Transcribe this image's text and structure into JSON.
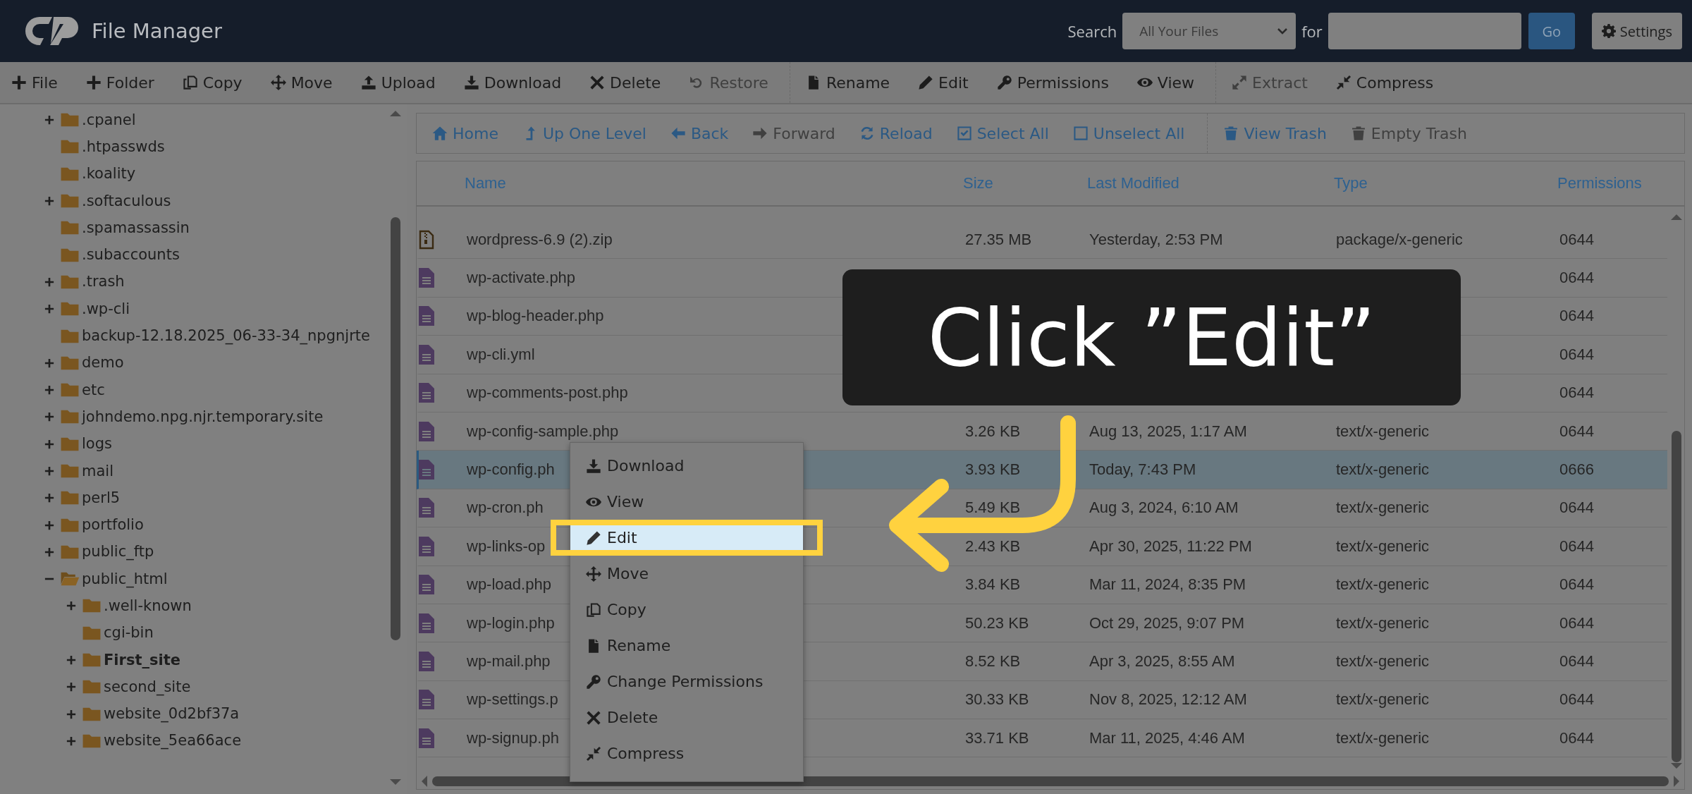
{
  "header": {
    "title": "File Manager",
    "search_label": "Search",
    "search_scope": "All Your Files",
    "for_label": "for",
    "go": "Go",
    "settings": "Settings"
  },
  "toolbar": [
    {
      "items": [
        {
          "kind": "file",
          "label": "File",
          "disabled": false
        },
        {
          "kind": "folder",
          "label": "Folder",
          "disabled": false
        },
        {
          "kind": "copy",
          "label": "Copy",
          "disabled": false
        },
        {
          "kind": "move",
          "label": "Move",
          "disabled": false
        },
        {
          "kind": "upload",
          "label": "Upload",
          "disabled": false
        },
        {
          "kind": "download",
          "label": "Download",
          "disabled": false
        },
        {
          "kind": "delete",
          "label": "Delete",
          "disabled": false
        },
        {
          "kind": "restore",
          "label": "Restore",
          "disabled": true
        }
      ]
    },
    {
      "items": [
        {
          "kind": "rename",
          "label": "Rename",
          "disabled": false
        },
        {
          "kind": "edit",
          "label": "Edit",
          "disabled": false
        },
        {
          "kind": "permissions",
          "label": "Permissions",
          "disabled": false
        },
        {
          "kind": "view",
          "label": "View",
          "disabled": false
        }
      ]
    },
    {
      "items": [
        {
          "kind": "extract",
          "label": "Extract",
          "disabled": true
        },
        {
          "kind": "compress",
          "label": "Compress",
          "disabled": false
        }
      ]
    }
  ],
  "tree": [
    {
      "label": ".cpanel",
      "expandable": true,
      "expanded": false,
      "selected": false
    },
    {
      "label": ".htpasswds",
      "expandable": false,
      "expanded": false,
      "selected": false
    },
    {
      "label": ".koality",
      "expandable": false,
      "expanded": false,
      "selected": false
    },
    {
      "label": ".softaculous",
      "expandable": true,
      "expanded": false,
      "selected": false
    },
    {
      "label": ".spamassassin",
      "expandable": false,
      "expanded": false,
      "selected": false
    },
    {
      "label": ".subaccounts",
      "expandable": false,
      "expanded": false,
      "selected": false
    },
    {
      "label": ".trash",
      "expandable": true,
      "expanded": false,
      "selected": false
    },
    {
      "label": ".wp-cli",
      "expandable": true,
      "expanded": false,
      "selected": false
    },
    {
      "label": "backup-12.18.2025_06-33-34_npgnjrte",
      "expandable": false,
      "expanded": false,
      "selected": false
    },
    {
      "label": "demo",
      "expandable": true,
      "expanded": false,
      "selected": false
    },
    {
      "label": "etc",
      "expandable": true,
      "expanded": false,
      "selected": false
    },
    {
      "label": "johndemo.npg.njr.temporary.site",
      "expandable": true,
      "expanded": false,
      "selected": false
    },
    {
      "label": "logs",
      "expandable": true,
      "expanded": false,
      "selected": false
    },
    {
      "label": "mail",
      "expandable": true,
      "expanded": false,
      "selected": false
    },
    {
      "label": "perl5",
      "expandable": true,
      "expanded": false,
      "selected": false
    },
    {
      "label": "portfolio",
      "expandable": true,
      "expanded": false,
      "selected": false
    },
    {
      "label": "public_ftp",
      "expandable": true,
      "expanded": false,
      "selected": false
    },
    {
      "label": "public_html",
      "expandable": true,
      "expanded": true,
      "selected": false,
      "children": [
        {
          "label": ".well-known",
          "expandable": true,
          "expanded": false,
          "selected": false
        },
        {
          "label": "cgi-bin",
          "expandable": false,
          "expanded": false,
          "selected": false
        },
        {
          "label": "First_site",
          "expandable": true,
          "expanded": false,
          "selected": true
        },
        {
          "label": "second_site",
          "expandable": true,
          "expanded": false,
          "selected": false
        },
        {
          "label": "website_0d2bf37a",
          "expandable": true,
          "expanded": false,
          "selected": false
        },
        {
          "label": "website_5ea66ace",
          "expandable": true,
          "expanded": false,
          "selected": false
        }
      ]
    }
  ],
  "nav": [
    {
      "items": [
        {
          "kind": "home",
          "label": "Home",
          "disabled": false
        },
        {
          "kind": "up",
          "label": "Up One Level",
          "disabled": false
        },
        {
          "kind": "back",
          "label": "Back",
          "disabled": false
        },
        {
          "kind": "forward",
          "label": "Forward",
          "disabled": true
        },
        {
          "kind": "reload",
          "label": "Reload",
          "disabled": false
        },
        {
          "kind": "select",
          "label": "Select All",
          "disabled": false
        },
        {
          "kind": "unselect",
          "label": "Unselect All",
          "disabled": false
        }
      ]
    },
    {
      "items": [
        {
          "kind": "trash",
          "label": "View Trash",
          "disabled": false
        },
        {
          "kind": "trash",
          "label": "Empty Trash",
          "disabled": true
        }
      ]
    }
  ],
  "table": {
    "columns": [
      "Name",
      "Size",
      "Last Modified",
      "Type",
      "Permissions"
    ],
    "rows": [
      {
        "kind": "archive",
        "name": "wordpress-6.9 (2).zip",
        "size": "27.35 MB",
        "modified": "Yesterday, 2:53 PM",
        "type": "package/x-generic",
        "permissions": "0644",
        "selected": false
      },
      {
        "kind": "text",
        "name": "wp-activate.php",
        "permissions": "0644",
        "selected": false
      },
      {
        "kind": "text",
        "name": "wp-blog-header.php",
        "permissions": "0644",
        "selected": false
      },
      {
        "kind": "text",
        "name": "wp-cli.yml",
        "permissions": "0644",
        "selected": false
      },
      {
        "kind": "text",
        "name": "wp-comments-post.php",
        "permissions": "0644",
        "selected": false
      },
      {
        "kind": "text",
        "name": "wp-config-sample.php",
        "size": "3.26 KB",
        "modified": "Aug 13, 2025, 1:17 AM",
        "type": "text/x-generic",
        "permissions": "0644",
        "selected": false
      },
      {
        "kind": "text",
        "name": "wp-config.ph",
        "size": "3.93 KB",
        "modified": "Today, 7:43 PM",
        "type": "text/x-generic",
        "permissions": "0666",
        "selected": true
      },
      {
        "kind": "text",
        "name": "wp-cron.ph",
        "size": "5.49 KB",
        "modified": "Aug 3, 2024, 6:10 AM",
        "type": "text/x-generic",
        "permissions": "0644",
        "selected": false
      },
      {
        "kind": "text",
        "name": "wp-links-op",
        "size": "2.43 KB",
        "modified": "Apr 30, 2025, 11:22 PM",
        "type": "text/x-generic",
        "permissions": "0644",
        "selected": false
      },
      {
        "kind": "text",
        "name": "wp-load.php",
        "size": "3.84 KB",
        "modified": "Mar 11, 2024, 8:35 PM",
        "type": "text/x-generic",
        "permissions": "0644",
        "selected": false
      },
      {
        "kind": "text",
        "name": "wp-login.php",
        "size": "50.23 KB",
        "modified": "Oct 29, 2025, 9:07 PM",
        "type": "text/x-generic",
        "permissions": "0644",
        "selected": false
      },
      {
        "kind": "text",
        "name": "wp-mail.php",
        "size": "8.52 KB",
        "modified": "Apr 3, 2025, 8:55 AM",
        "type": "text/x-generic",
        "permissions": "0644",
        "selected": false
      },
      {
        "kind": "text",
        "name": "wp-settings.p",
        "size": "30.33 KB",
        "modified": "Nov 8, 2025, 12:12 AM",
        "type": "text/x-generic",
        "permissions": "0644",
        "selected": false
      },
      {
        "kind": "text",
        "name": "wp-signup.ph",
        "size": "33.71 KB",
        "modified": "Mar 11, 2025, 4:46 AM",
        "type": "text/x-generic",
        "permissions": "0644",
        "selected": false
      }
    ]
  },
  "context_menu": {
    "items": [
      {
        "kind": "download",
        "label": "Download",
        "selected": false
      },
      {
        "kind": "view",
        "label": "View",
        "selected": false
      },
      {
        "kind": "edit",
        "label": "Edit",
        "selected": true
      },
      {
        "kind": "move",
        "label": "Move",
        "selected": false
      },
      {
        "kind": "copy",
        "label": "Copy",
        "selected": false
      },
      {
        "kind": "rename",
        "label": "Rename",
        "selected": false
      },
      {
        "kind": "permissions",
        "label": "Change Permissions",
        "selected": false
      },
      {
        "kind": "delete",
        "label": "Delete",
        "selected": false
      },
      {
        "kind": "compress",
        "label": "Compress",
        "selected": false
      }
    ]
  },
  "callout": {
    "text": "Click ”Edit”"
  }
}
